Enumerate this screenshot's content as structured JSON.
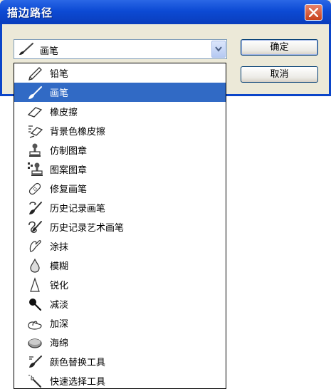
{
  "window": {
    "title": "描边路径",
    "title_color": "#0c4ad4",
    "close_icon": "close-icon"
  },
  "tool_select": {
    "selected_label": "画笔",
    "selected_icon": "brush-icon"
  },
  "buttons": {
    "ok_label": "确定",
    "cancel_label": "取消"
  },
  "tool_options": [
    {
      "label": "铅笔",
      "icon": "pencil-icon",
      "selected": false
    },
    {
      "label": "画笔",
      "icon": "brush-icon",
      "selected": true
    },
    {
      "label": "橡皮擦",
      "icon": "eraser-icon",
      "selected": false
    },
    {
      "label": "背景色橡皮擦",
      "icon": "background-eraser-icon",
      "selected": false
    },
    {
      "label": "仿制图章",
      "icon": "clone-stamp-icon",
      "selected": false
    },
    {
      "label": "图案图章",
      "icon": "pattern-stamp-icon",
      "selected": false
    },
    {
      "label": "修复画笔",
      "icon": "healing-brush-icon",
      "selected": false
    },
    {
      "label": "历史记录画笔",
      "icon": "history-brush-icon",
      "selected": false
    },
    {
      "label": "历史记录艺术画笔",
      "icon": "art-history-brush-icon",
      "selected": false
    },
    {
      "label": "涂抹",
      "icon": "smudge-icon",
      "selected": false
    },
    {
      "label": "模糊",
      "icon": "blur-icon",
      "selected": false
    },
    {
      "label": "锐化",
      "icon": "sharpen-icon",
      "selected": false
    },
    {
      "label": "减淡",
      "icon": "dodge-icon",
      "selected": false
    },
    {
      "label": "加深",
      "icon": "burn-icon",
      "selected": false
    },
    {
      "label": "海绵",
      "icon": "sponge-icon",
      "selected": false
    },
    {
      "label": "颜色替换工具",
      "icon": "color-replacement-icon",
      "selected": false
    },
    {
      "label": "快速选择工具",
      "icon": "quick-selection-icon",
      "selected": false
    }
  ],
  "colors": {
    "selection_bg": "#316ac5",
    "dialog_bg": "#ece9d8"
  }
}
